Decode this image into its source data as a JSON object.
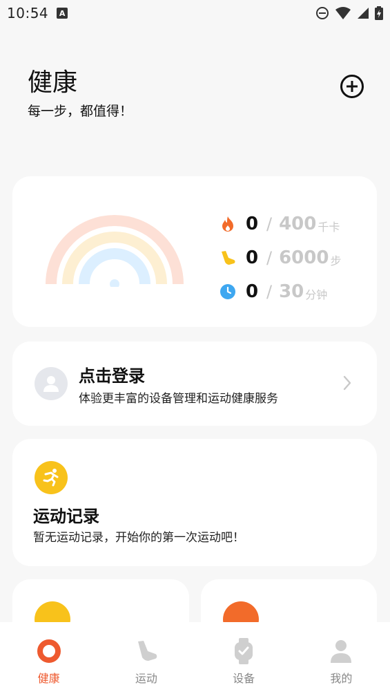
{
  "status_bar": {
    "time": "10:54",
    "notification_letter": "A"
  },
  "header": {
    "title": "健康",
    "subtitle": "每一步，都值得！"
  },
  "summary": {
    "metrics": [
      {
        "icon": "flame-icon",
        "current": "0",
        "separator": "/",
        "goal": "400",
        "unit": "千卡",
        "color": "#f26b2a"
      },
      {
        "icon": "shoe-icon",
        "current": "0",
        "separator": "/",
        "goal": "6000",
        "unit": "步",
        "color": "#f8c21b"
      },
      {
        "icon": "clock-icon",
        "current": "0",
        "separator": "/",
        "goal": "30",
        "unit": "分钟",
        "color": "#3ea7f0"
      }
    ],
    "ring_colors": [
      "#fde0d6",
      "#fdefd2",
      "#dcefff"
    ]
  },
  "login": {
    "title": "点击登录",
    "description": "体验更丰富的设备管理和运动健康服务"
  },
  "record": {
    "title": "运动记录",
    "description": "暂无运动记录，开始你的第一次运动吧！",
    "icon_color": "#f8c21b"
  },
  "mini_cards": [
    {
      "icon_color": "#f8c21b"
    },
    {
      "icon_color": "#f26b2a"
    }
  ],
  "tabs": [
    {
      "label": "健康",
      "active": true
    },
    {
      "label": "运动",
      "active": false
    },
    {
      "label": "设备",
      "active": false
    },
    {
      "label": "我的",
      "active": false
    }
  ],
  "colors": {
    "accent": "#ee5a2f",
    "inactive": "#c8c8c8"
  }
}
